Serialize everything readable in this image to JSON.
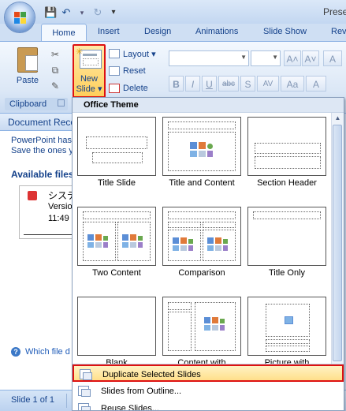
{
  "window": {
    "title": "Prese"
  },
  "quick_access": {
    "icons": [
      "save-icon",
      "undo-icon",
      "redo-icon",
      "customize-icon"
    ]
  },
  "tabs": [
    "Home",
    "Insert",
    "Design",
    "Animations",
    "Slide Show",
    "Rev"
  ],
  "ribbon": {
    "clipboard": {
      "paste_label": "Paste",
      "group_label": "Clipboard"
    },
    "slides": {
      "new_slide_line1": "New",
      "new_slide_line2": "Slide ▾",
      "layout_label": "Layout ▾",
      "reset_label": "Reset",
      "delete_label": "Delete"
    },
    "font": {
      "grow": "A˄",
      "shrink": "A˅",
      "clear": "A",
      "bold": "B",
      "italic": "I",
      "underline": "U",
      "strike": "abc",
      "shadow": "S",
      "spacing": "AV",
      "case": "Aa",
      "color": "A"
    }
  },
  "recovery_pane": {
    "header": "Document Reco",
    "message_line1": "PowerPoint has",
    "message_line2": "Save the ones y",
    "available_files": "Available files",
    "file_name": "システ",
    "file_version": "Version",
    "file_time": "11:49",
    "help_link": "Which file d"
  },
  "status_bar": {
    "slide_indicator": "Slide 1 of 1"
  },
  "gallery": {
    "section_title": "Office Theme",
    "layouts": [
      "Title Slide",
      "Title and Content",
      "Section Header",
      "Two Content",
      "Comparison",
      "Title Only",
      "Blank",
      "Content with",
      "Picture with"
    ],
    "menu_items": [
      "Duplicate Selected Slides",
      "Slides from Outline...",
      "Reuse Slides..."
    ]
  }
}
